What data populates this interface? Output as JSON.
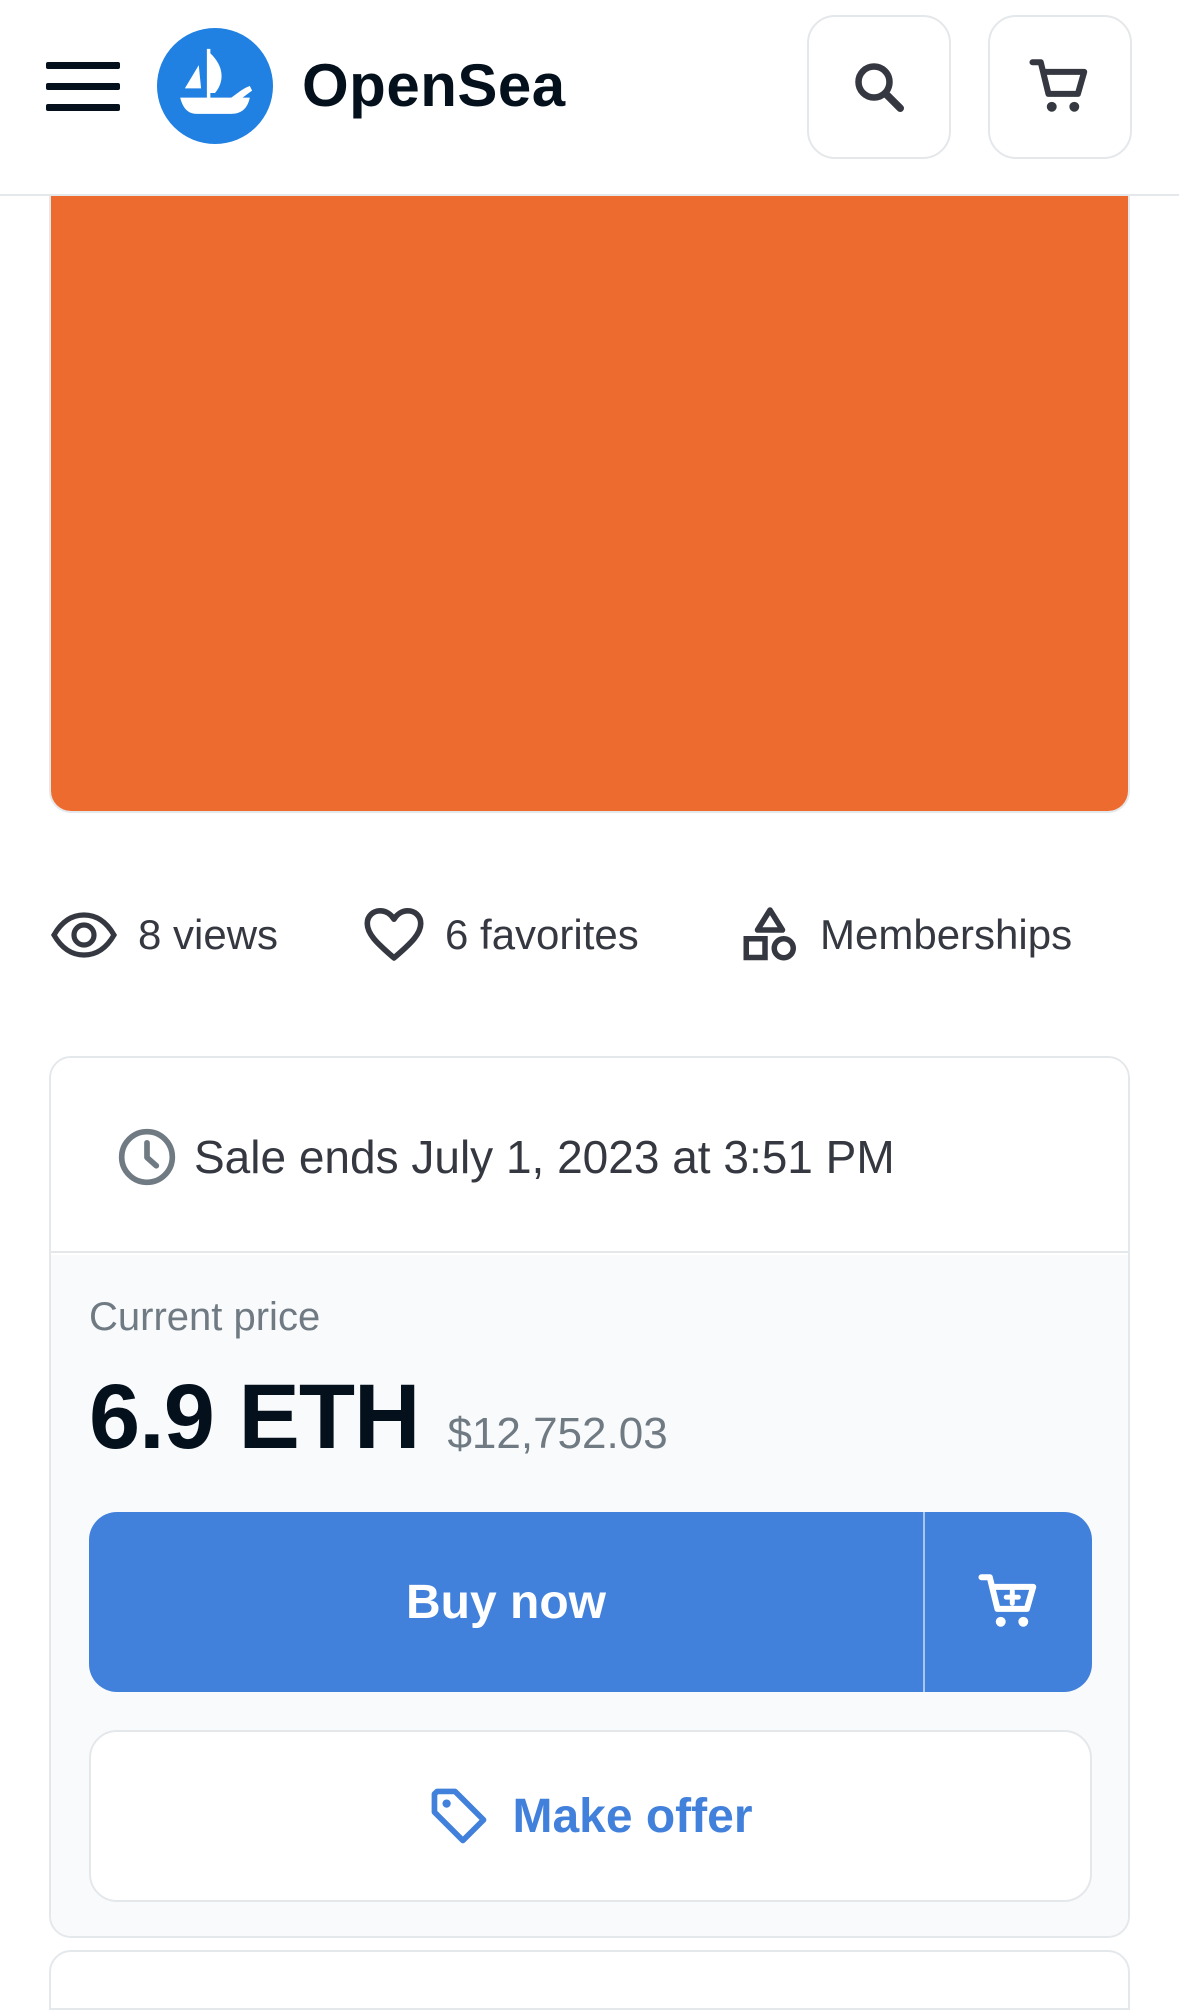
{
  "header": {
    "brand_name": "OpenSea"
  },
  "hero": {
    "color": "#ed6b2f"
  },
  "stats": {
    "views": "8 views",
    "favorites": "6 favorites",
    "category": "Memberships"
  },
  "sale": {
    "ends_text": "Sale ends July 1, 2023 at 3:51 PM"
  },
  "pricing": {
    "label": "Current price",
    "eth": "6.9 ETH",
    "usd": "$12,752.03"
  },
  "actions": {
    "buy_now_label": "Buy now",
    "make_offer_label": "Make offer"
  },
  "colors": {
    "accent": "#4281db",
    "text_primary": "#04111d",
    "text_secondary": "#707a83",
    "border": "#e5e8eb"
  },
  "icons": {
    "menu": "hamburger-menu-icon",
    "logo": "opensea-ship-logo",
    "search": "search-icon",
    "cart": "cart-icon",
    "views": "eye-icon",
    "favorites": "heart-icon",
    "category": "shapes-icon",
    "sale_time": "clock-icon",
    "offer": "tag-icon"
  }
}
